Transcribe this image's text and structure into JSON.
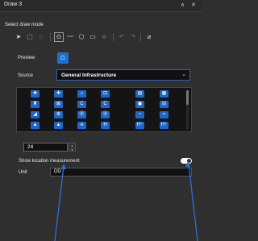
{
  "window": {
    "title": "Draw 3",
    "buttons": {
      "collapse": "∧",
      "close": "✕"
    }
  },
  "draw_mode": {
    "label": "Select draw mode",
    "tools": [
      {
        "name": "select-tool",
        "glyph": "➤",
        "enabled": true,
        "selected": false
      },
      {
        "name": "select-rect-tool",
        "glyph": "⬚",
        "enabled": true,
        "selected": false
      },
      {
        "name": "select-lasso-tool",
        "glyph": "◌",
        "enabled": true,
        "selected": false
      },
      {
        "name": "point-tool",
        "glyph": "⊙",
        "enabled": true,
        "selected": true
      },
      {
        "name": "polyline-tool",
        "glyph": "〰",
        "enabled": true,
        "selected": false
      },
      {
        "name": "polygon-tool",
        "glyph": "⬠",
        "enabled": true,
        "selected": false
      },
      {
        "name": "rectangle-tool",
        "glyph": "▭",
        "enabled": true,
        "selected": false
      },
      {
        "name": "circle-tool",
        "glyph": "○",
        "enabled": true,
        "selected": false
      },
      {
        "name": "undo-tool",
        "glyph": "↶",
        "enabled": false,
        "selected": false
      },
      {
        "name": "redo-tool",
        "glyph": "↷",
        "enabled": false,
        "selected": false
      },
      {
        "name": "erase-tool",
        "glyph": "⌀",
        "enabled": true,
        "selected": false
      }
    ]
  },
  "preview": {
    "label": "Preview",
    "icon": "home-icon",
    "glyph": "⌂"
  },
  "source": {
    "label": "Source",
    "value": "General Infrastructure"
  },
  "symbol_grid": {
    "rows": [
      [
        "✚",
        "✚",
        "⌂",
        "⊡",
        "▤",
        "▦"
      ],
      [
        "♜",
        "⊠",
        "C",
        "C",
        "◼",
        "⊟"
      ],
      [
        "◢",
        "⚙",
        "⦿",
        "⦿",
        "◔",
        "◓"
      ],
      [
        "▲",
        "▲",
        "⍾",
        "H",
        "H⁺",
        "H⁺"
      ]
    ]
  },
  "size": {
    "value": "24"
  },
  "location_measurement": {
    "label": "Show location measurement",
    "enabled": true
  },
  "unit": {
    "label": "Unit",
    "value": "DD"
  },
  "colors": {
    "accent": "#1e6fcf",
    "background": "#2f2f2f",
    "arrow": "#2f6fd6"
  }
}
